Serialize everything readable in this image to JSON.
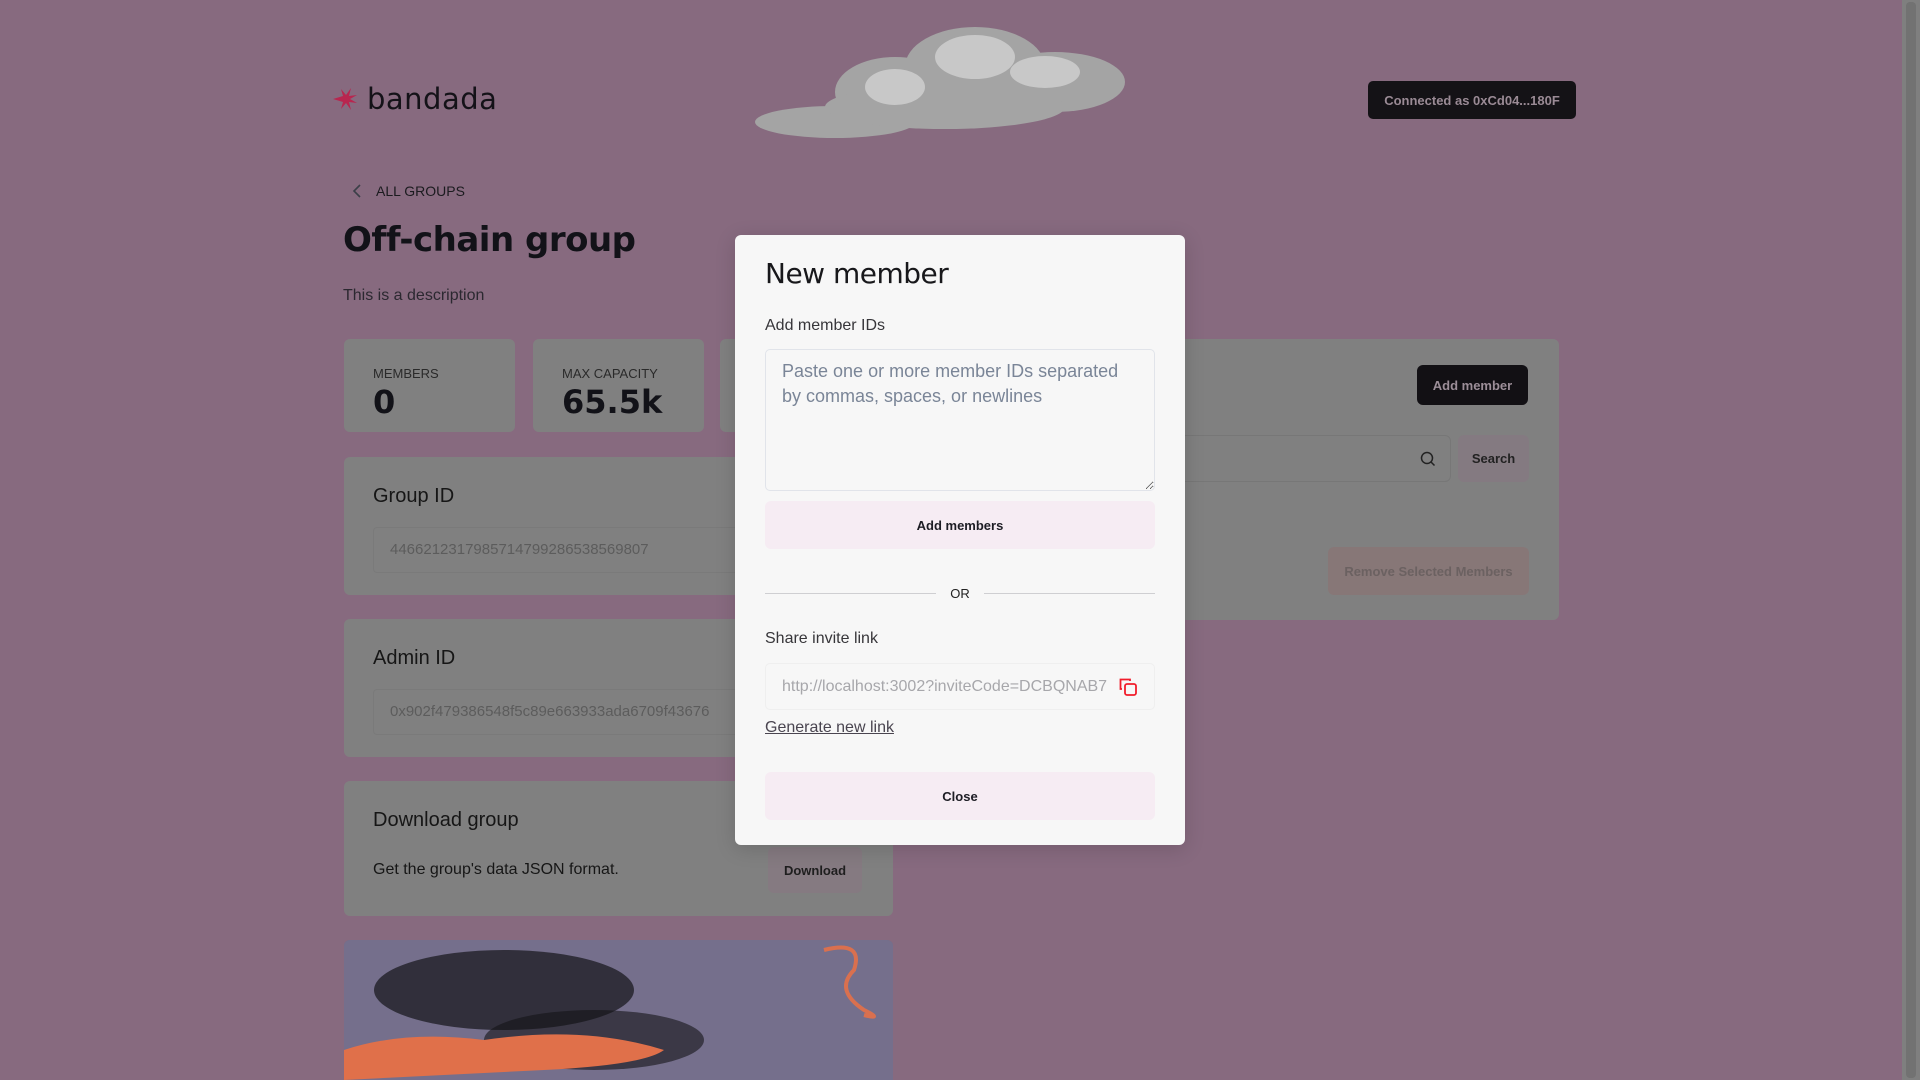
{
  "header": {
    "logo_text": "bandada",
    "connected_label": "Connected as 0xCd04...180F"
  },
  "nav": {
    "back_label": "ALL GROUPS"
  },
  "group": {
    "title": "Off-chain group",
    "description": "This is a description",
    "stats": [
      {
        "label": "MEMBERS",
        "value": "0"
      },
      {
        "label": "MAX CAPACITY",
        "value": "65.5k"
      }
    ],
    "group_id": {
      "title": "Group ID",
      "value": "4466212317985714799286538569807"
    },
    "admin_id": {
      "title": "Admin ID",
      "value": "0x902f479386548f5c89e663933ada6709f43676"
    },
    "download": {
      "title": "Download group",
      "text": "Get the group's data JSON format.",
      "button": "Download"
    }
  },
  "members_panel": {
    "add_member_button": "Add member",
    "search_button": "Search",
    "remove_button": "Remove Selected Members"
  },
  "modal": {
    "title": "New member",
    "ids_label": "Add member IDs",
    "ids_placeholder": "Paste one or more member IDs separated by commas, spaces, or newlines",
    "add_button": "Add members",
    "or_text": "OR",
    "invite_label": "Share invite link",
    "invite_link": "http://localhost:3002?inviteCode=DCBQNAB7",
    "generate_link": "Generate new link",
    "close_button": "Close"
  },
  "colors": {
    "accent": "#f11d2b",
    "brand_logo": "#d6265f",
    "dark_button": "#121014",
    "soft_button": "#f6ecf3"
  },
  "icons": {
    "back": "chevron-left-icon",
    "search": "search-icon",
    "copy": "copy-icon"
  }
}
